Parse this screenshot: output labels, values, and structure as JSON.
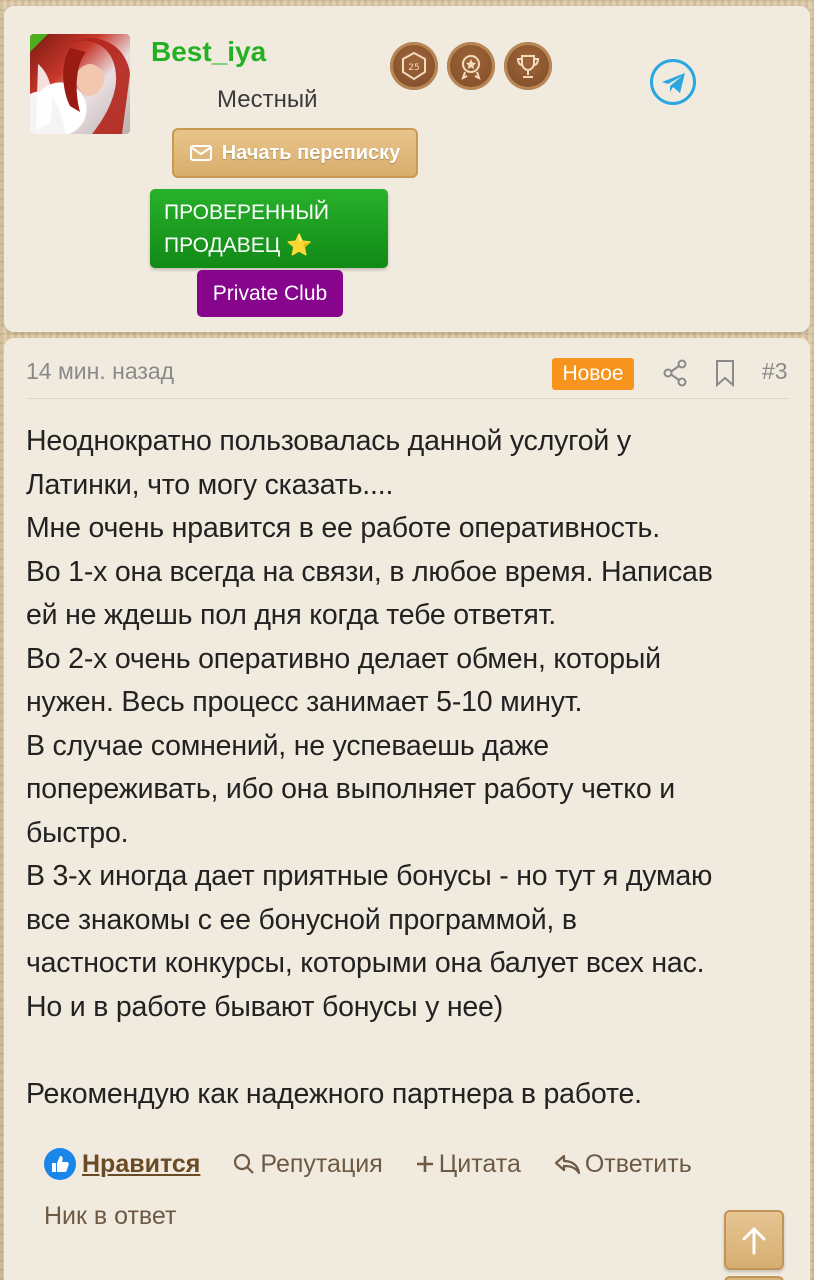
{
  "user": {
    "name": "Best_iya",
    "title": "Местный",
    "trophies": [
      "25-years-badge-icon",
      "medal-icon",
      "cup-icon"
    ],
    "pm_button": "Начать переписку",
    "banner_verified_line1": "ПРОВЕРЕННЫЙ",
    "banner_verified_line2": "ПРОДАВЕЦ ⭐",
    "banner_club": "Private Club",
    "trophy_25_label": "25"
  },
  "post": {
    "time": "14 мин. назад",
    "badge": "Новое",
    "number": "#3",
    "lines": [
      "Неоднократно пользовалась данной услугой у",
      "Латинки, что могу сказать....",
      "Мне очень нравится в ее работе оперативность.",
      "Во 1-х она всегда на связи, в любое время. Написав",
      "ей не ждешь пол дня когда тебе ответят.",
      "Во 2-х очень оперативно делает обмен, который",
      "нужен. Весь процесс занимает 5-10 минут.",
      "В случае сомнений, не успеваешь даже",
      "попереживать, ибо она выполняет работу четко и",
      "быстро.",
      "В 3-х иногда дает приятные бонусы - но тут я думаю",
      "все знакомы с ее бонусной программой, в",
      "частности конкурсы, которыми она балует всех нас.",
      "Но и в работе бывают бонусы у нее)",
      "",
      "Рекомендую как надежного партнера в работе."
    ]
  },
  "actions": {
    "like": "Нравится",
    "reputation": "Репутация",
    "quote": "Цитата",
    "reply": "Ответить",
    "nick_reply": "Ник в ответ"
  },
  "colors": {
    "username": "#23b123",
    "verified_banner": "#1a9c1e",
    "club_banner": "#86058c",
    "new_badge": "#f7941d",
    "accent_brown": "#6b4a26",
    "like_blue": "#1b86e9",
    "telegram": "#2aa6e0"
  }
}
